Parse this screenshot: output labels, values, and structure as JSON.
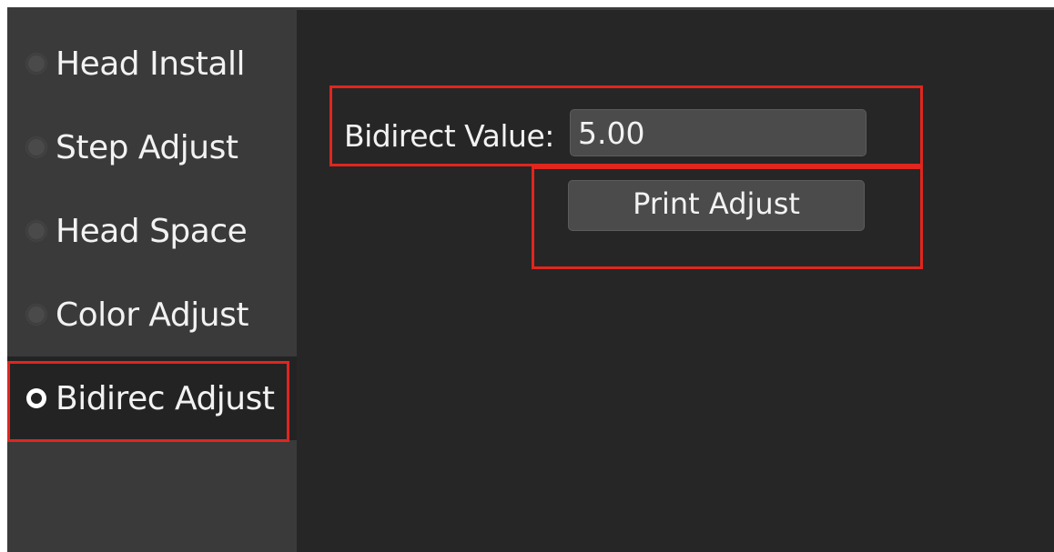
{
  "sidebar": {
    "items": [
      {
        "label": "Head Install",
        "selected": false
      },
      {
        "label": "Step Adjust",
        "selected": false
      },
      {
        "label": "Head Space",
        "selected": false
      },
      {
        "label": "Color Adjust",
        "selected": false
      },
      {
        "label": "Bidirec Adjust",
        "selected": true
      }
    ]
  },
  "main": {
    "bidirect_label": "Bidirect Value:",
    "bidirect_value": "5.00",
    "print_button_label": "Print Adjust"
  },
  "colors": {
    "highlight": "#e0261e",
    "sidebar_bg": "#3a3a3a",
    "main_bg": "#262626"
  }
}
